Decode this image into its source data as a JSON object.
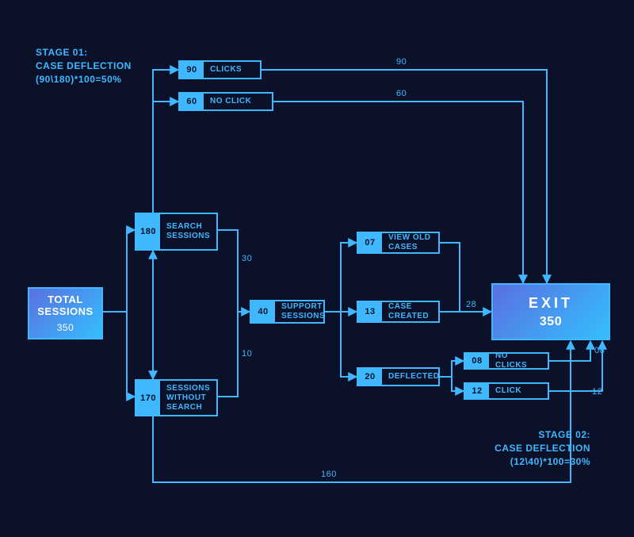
{
  "total": {
    "label": "TOTAL SESSIONS",
    "value": "350"
  },
  "exit": {
    "label": "EXIT",
    "value": "350"
  },
  "nodes": {
    "search_sessions": {
      "n": "180",
      "label": "SEARCH SESSIONS"
    },
    "sessions_no_search": {
      "n": "170",
      "label": "SESSIONS WITHOUT SEARCH"
    },
    "clicks": {
      "n": "90",
      "label": "CLICKS"
    },
    "no_click": {
      "n": "60",
      "label": "NO CLICK"
    },
    "support_sessions": {
      "n": "40",
      "label": "SUPPORT SESSIONS"
    },
    "view_old_cases": {
      "n": "07",
      "label": "VIEW OLD CASES"
    },
    "case_created": {
      "n": "13",
      "label": "CASE CREATED"
    },
    "deflected": {
      "n": "20",
      "label": "DEFLECTED"
    },
    "no_clicks2": {
      "n": "08",
      "label": "NO CLICKS"
    },
    "click2": {
      "n": "12",
      "label": "CLICK"
    }
  },
  "edges": {
    "e90": "90",
    "e60": "60",
    "e30": "30",
    "e10": "10",
    "e28": "28",
    "e160": "160",
    "e08": "08",
    "e12": "12"
  },
  "stage1": {
    "title": "STAGE 01:",
    "sub": "CASE DEFLECTION",
    "calc": "(90\\180)*100=50%"
  },
  "stage2": {
    "title": "STAGE 02:",
    "sub": "CASE DEFLECTION",
    "calc": "(12\\40)*100=30%"
  }
}
